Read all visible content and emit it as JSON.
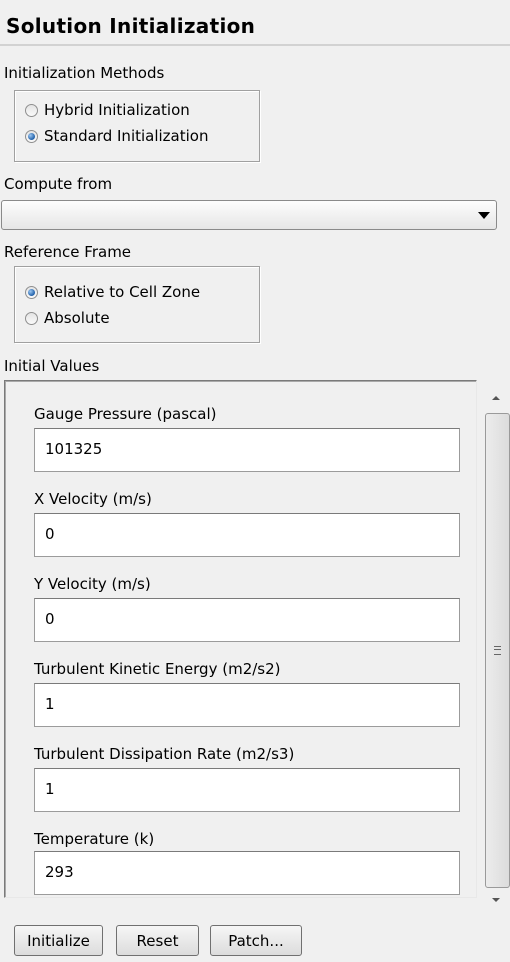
{
  "panel": {
    "title": "Solution Initialization"
  },
  "init_methods": {
    "label": "Initialization Methods",
    "options": [
      {
        "label": "Hybrid  Initialization",
        "checked": false
      },
      {
        "label": "Standard Initialization",
        "checked": true
      }
    ]
  },
  "compute_from": {
    "label": "Compute from",
    "value": ""
  },
  "reference_frame": {
    "label": "Reference Frame",
    "options": [
      {
        "label": "Relative to Cell Zone",
        "checked": true
      },
      {
        "label": "Absolute",
        "checked": false
      }
    ]
  },
  "initial_values": {
    "label": "Initial Values",
    "fields": [
      {
        "label": "Gauge Pressure (pascal)",
        "value": "101325"
      },
      {
        "label": "X Velocity (m/s)",
        "value": "0"
      },
      {
        "label": "Y Velocity (m/s)",
        "value": "0"
      },
      {
        "label": "Turbulent Kinetic Energy (m2/s2)",
        "value": "1"
      },
      {
        "label": "Turbulent Dissipation Rate (m2/s3)",
        "value": "1"
      },
      {
        "label": "Temperature (k)",
        "value": "293"
      }
    ]
  },
  "buttons": {
    "initialize": "Initialize",
    "reset": "Reset",
    "patch": "Patch..."
  }
}
